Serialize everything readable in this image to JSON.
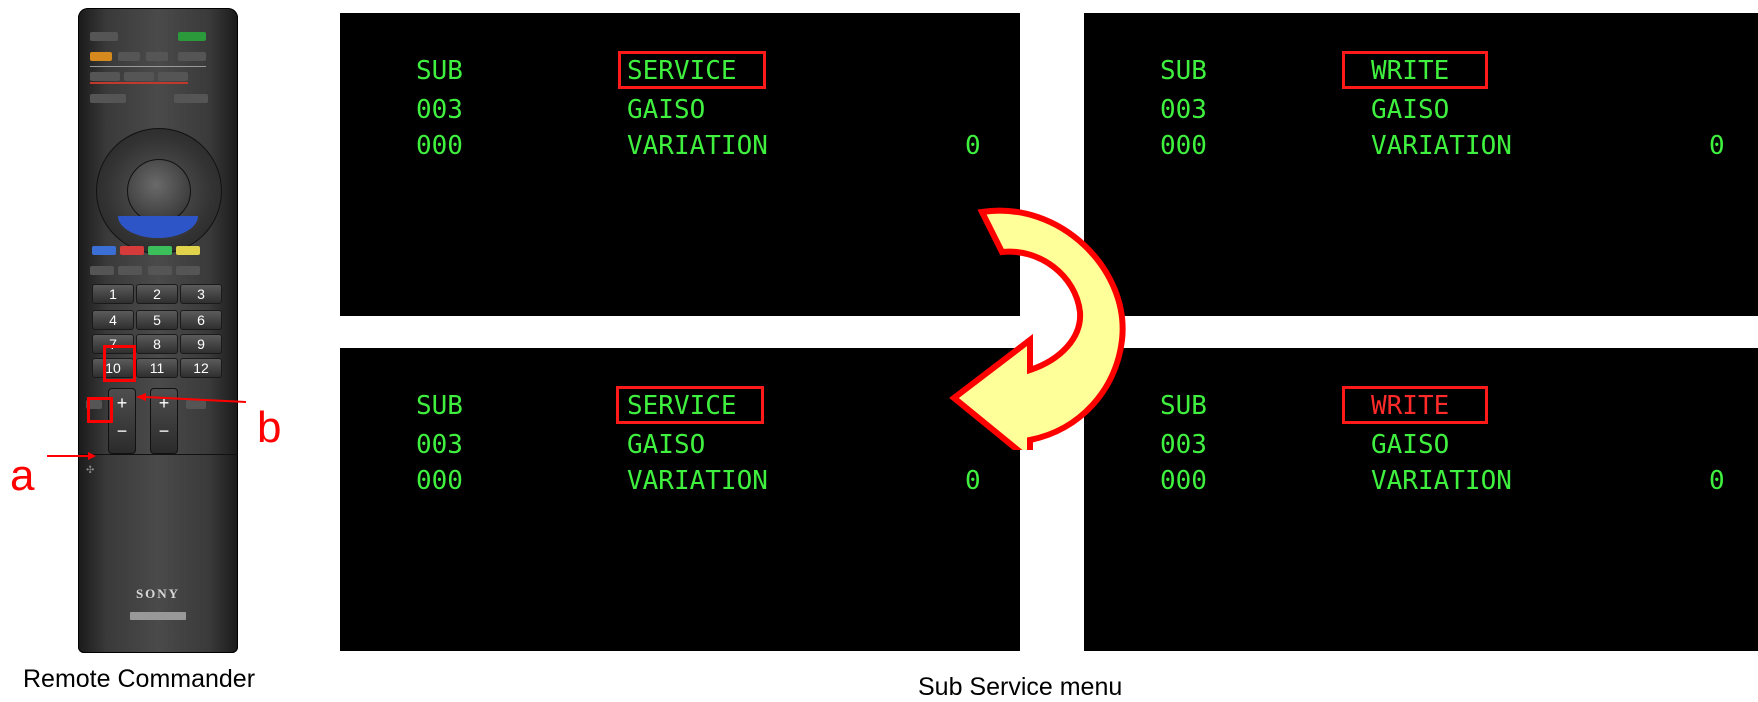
{
  "remote": {
    "caption": "Remote Commander",
    "brand": "SONY",
    "number_keys": [
      "1",
      "2",
      "3",
      "4",
      "5",
      "6",
      "7",
      "8",
      "9",
      "10",
      "11",
      "12"
    ],
    "plus_symbol": "+",
    "minus_symbol": "−",
    "callout_a": "a",
    "callout_b": "b",
    "highlight_color": "#ff0000"
  },
  "menu_caption": "Sub Service menu",
  "screens": [
    {
      "id": "top-left",
      "rows": [
        {
          "left": "SUB",
          "mid": "SERVICE",
          "right": ""
        },
        {
          "left": "003",
          "mid": "GAISO",
          "right": ""
        },
        {
          "left": "000",
          "mid": "VARIATION",
          "right": "0"
        }
      ],
      "highlight_text_color": "green"
    },
    {
      "id": "top-right",
      "rows": [
        {
          "left": "SUB",
          "mid": "WRITE",
          "right": ""
        },
        {
          "left": "003",
          "mid": "GAISO",
          "right": ""
        },
        {
          "left": "000",
          "mid": "VARIATION",
          "right": "0"
        }
      ],
      "highlight_text_color": "green"
    },
    {
      "id": "bottom-left",
      "rows": [
        {
          "left": "SUB",
          "mid": "SERVICE",
          "right": ""
        },
        {
          "left": "003",
          "mid": "GAISO",
          "right": ""
        },
        {
          "left": "000",
          "mid": "VARIATION",
          "right": "0"
        }
      ],
      "highlight_text_color": "green"
    },
    {
      "id": "bottom-right",
      "rows": [
        {
          "left": "SUB",
          "mid": "WRITE",
          "right": ""
        },
        {
          "left": "003",
          "mid": "GAISO",
          "right": ""
        },
        {
          "left": "000",
          "mid": "VARIATION",
          "right": "0"
        }
      ],
      "highlight_text_color": "red"
    }
  ],
  "colors": {
    "screen_text": "#3ff03f",
    "highlight_border": "#ff1a1a",
    "arrow_fill": "#ffff99",
    "arrow_stroke": "#ff0000"
  }
}
